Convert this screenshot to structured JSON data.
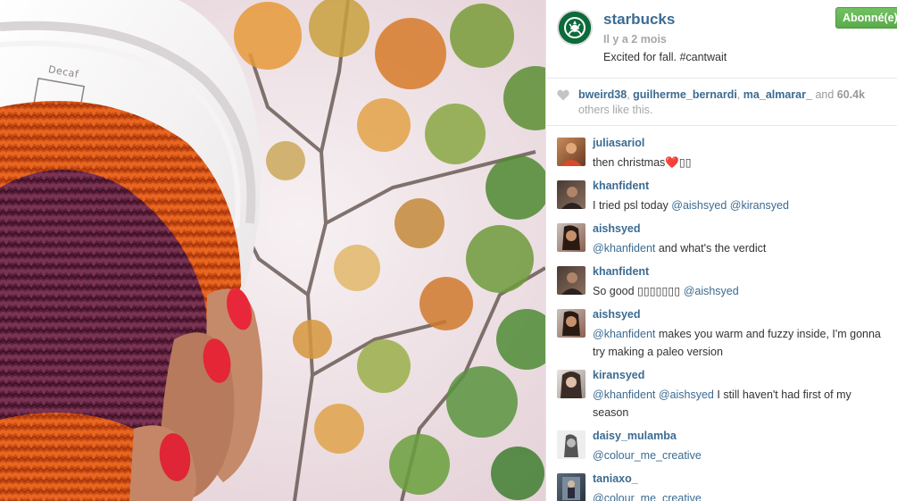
{
  "photo": {
    "cup_label": "Decaf"
  },
  "post": {
    "username": "starbucks",
    "time_ago": "Il y a 2 mois",
    "caption": "Excited for fall. #cantwait",
    "follow_label": "Abonné(e)",
    "logo_icon": "starbucks-siren-logo"
  },
  "likes": {
    "users": [
      "bweird38",
      "guilherme_bernardi",
      "ma_almarar_"
    ],
    "and_text": "and",
    "count": "60.4k",
    "others_text": "others like this."
  },
  "comments": [
    {
      "user": "juliasariol",
      "text": "then christmas❤️▯▯",
      "mentions": []
    },
    {
      "user": "khanfident",
      "text": "I tried psl today",
      "mentions": [
        "@aishsyed",
        "@kiransyed"
      ]
    },
    {
      "user": "aishsyed",
      "mention_first": "@khanfident",
      "text": "and what's the verdict"
    },
    {
      "user": "khanfident",
      "text": "So good ▯▯▯▯▯▯▯",
      "mentions": [
        "@aishsyed"
      ]
    },
    {
      "user": "aishsyed",
      "mention_first": "@khanfident",
      "text": "makes you warm and fuzzy inside, I'm gonna try making a paleo version"
    },
    {
      "user": "kiransyed",
      "mention_first": "@khanfident",
      "mention_second": "@aishsyed",
      "text": "I still haven't had first of my season"
    },
    {
      "user": "daisy_mulamba",
      "mention_first": "@colour_me_creative",
      "text": ""
    },
    {
      "user": "taniaxo_",
      "mention_first": "@colour_me_creative",
      "text": ""
    }
  ],
  "colors": {
    "link_blue": "#3b6b92",
    "follow_green": "#6bb85a",
    "starbucks_green": "#0b6b3a"
  }
}
